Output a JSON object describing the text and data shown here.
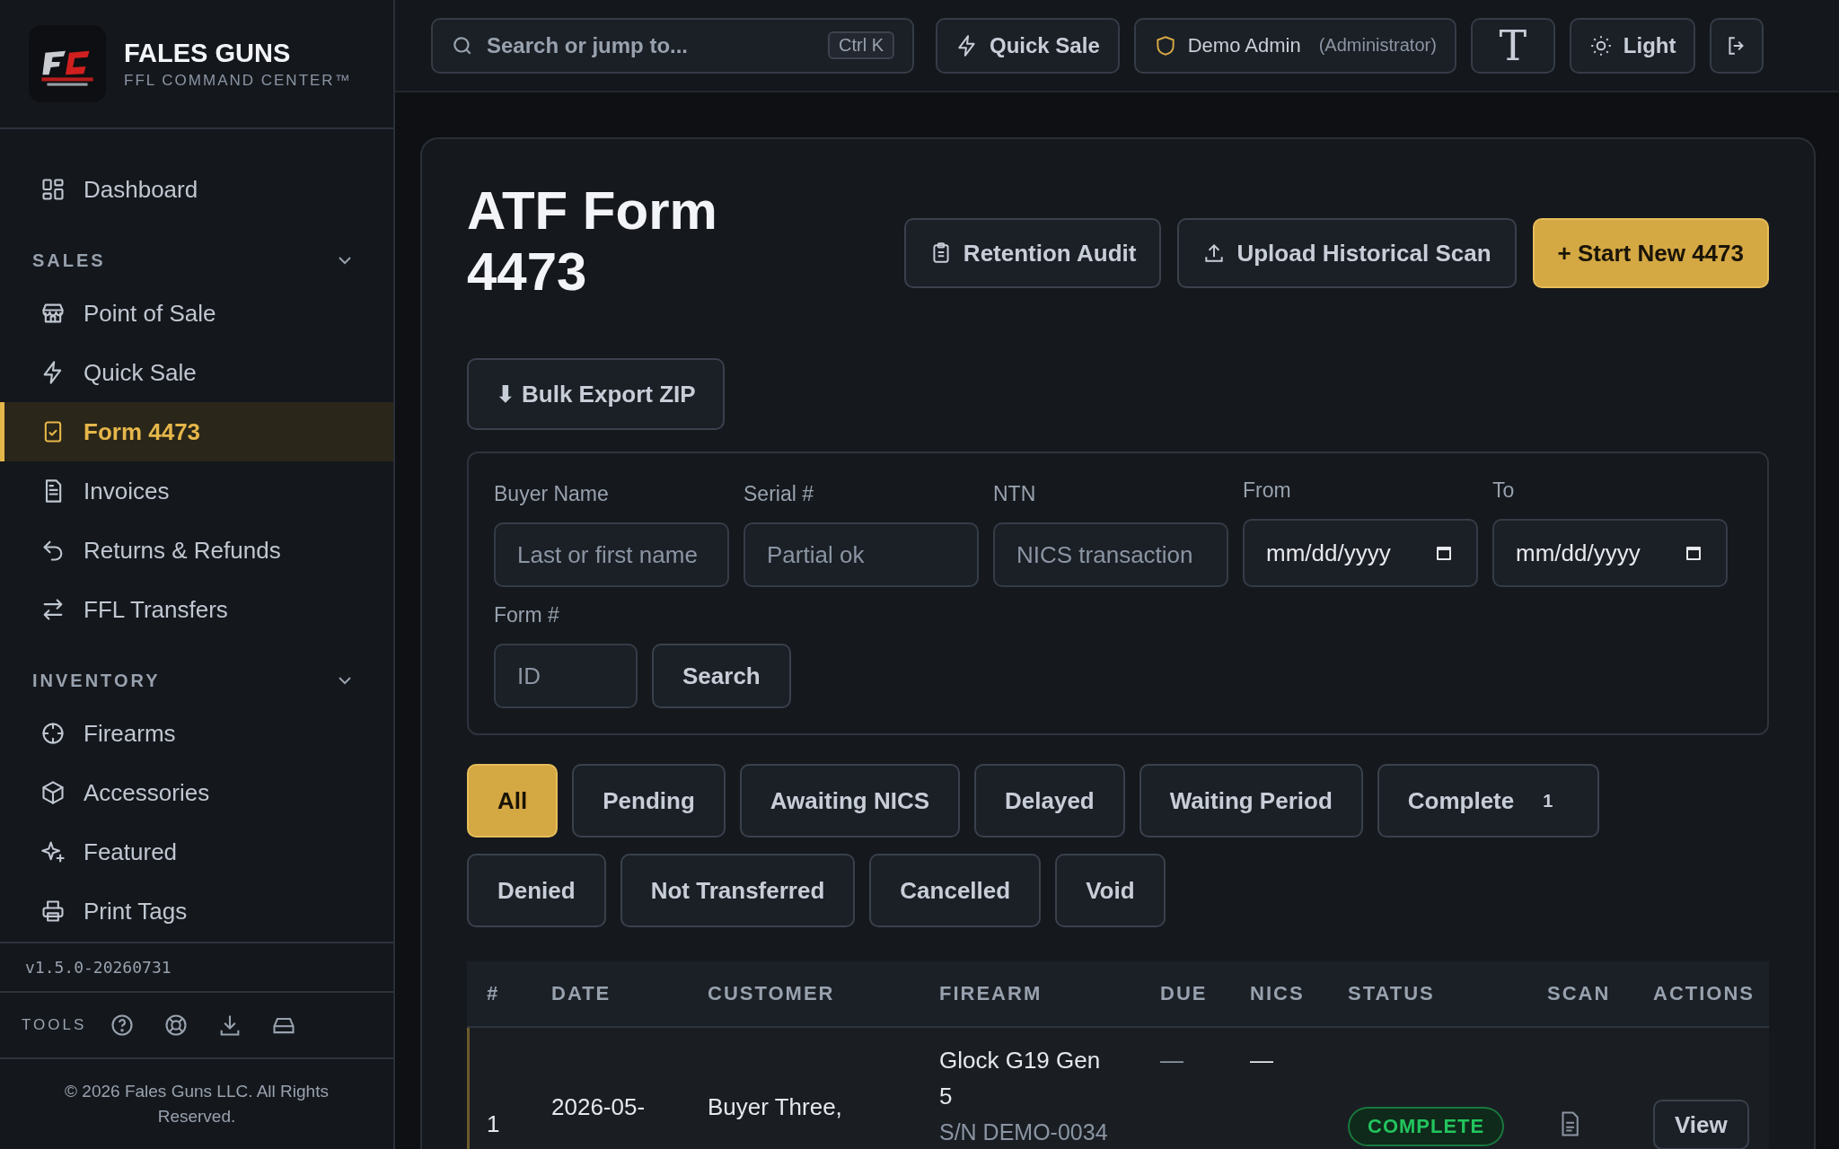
{
  "brand": {
    "name": "FALES GUNS",
    "tagline": "FFL COMMAND CENTER™"
  },
  "sidebar": {
    "top_items": [
      {
        "label": "Dashboard",
        "kind": "grid",
        "selected": false
      }
    ],
    "sections": [
      {
        "title": "SALES",
        "expanded": true,
        "items": [
          {
            "label": "Point of Sale",
            "kind": "store",
            "selected": false
          },
          {
            "label": "Quick Sale",
            "kind": "bolt",
            "selected": false
          },
          {
            "label": "Form 4473",
            "kind": "form",
            "selected": true
          },
          {
            "label": "Invoices",
            "kind": "doc",
            "selected": false
          },
          {
            "label": "Returns & Refunds",
            "kind": "undo",
            "selected": false
          },
          {
            "label": "FFL Transfers",
            "kind": "swap",
            "selected": false
          }
        ]
      },
      {
        "title": "INVENTORY",
        "expanded": true,
        "items": [
          {
            "label": "Firearms",
            "kind": "target",
            "selected": false
          },
          {
            "label": "Accessories",
            "kind": "box",
            "selected": false
          },
          {
            "label": "Featured",
            "kind": "sparkle",
            "selected": false
          },
          {
            "label": "Print Tags",
            "kind": "printer",
            "selected": false
          }
        ]
      }
    ],
    "version": "v1.5.0-20260731",
    "tools_label": "TOOLS",
    "copyright": "© 2026 Fales Guns LLC. All Rights Reserved."
  },
  "topbar": {
    "search": {
      "placeholder": "Search or jump to...",
      "shortcut": "Ctrl K"
    },
    "quick_sale": "Quick Sale",
    "user": {
      "name": "Demo Admin",
      "role": "(Administrator)"
    },
    "font_button": "T",
    "theme_button": "Light"
  },
  "page": {
    "title": "ATF Form 4473",
    "actions": [
      {
        "label": "Retention Audit",
        "kind": "audit"
      },
      {
        "label": "Upload Historical Scan",
        "kind": "upload"
      },
      {
        "label": "+ Start New 4473",
        "kind": "primary"
      }
    ],
    "bulk_export": "⬇ Bulk Export ZIP",
    "filters": [
      {
        "label": "Buyer Name",
        "placeholder": "Last or first name",
        "kind": "text"
      },
      {
        "label": "Serial #",
        "placeholder": "Partial ok",
        "kind": "text"
      },
      {
        "label": "NTN",
        "placeholder": "NICS transaction",
        "kind": "text"
      },
      {
        "label": "From",
        "value": "mm/dd/yyyy",
        "kind": "date"
      },
      {
        "label": "To",
        "value": "mm/dd/yyyy",
        "kind": "date"
      }
    ],
    "form_number": {
      "label": "Form #",
      "placeholder": "ID"
    },
    "search_button": "Search",
    "status_chips": [
      {
        "label": "All",
        "selected": true
      },
      {
        "label": "Pending",
        "selected": false
      },
      {
        "label": "Awaiting NICS",
        "selected": false
      },
      {
        "label": "Delayed",
        "selected": false
      },
      {
        "label": "Waiting Period",
        "selected": false
      },
      {
        "label": "Complete",
        "selected": false,
        "count": "1"
      },
      {
        "label": "Denied",
        "selected": false
      },
      {
        "label": "Not Transferred",
        "selected": false
      },
      {
        "label": "Cancelled",
        "selected": false
      },
      {
        "label": "Void",
        "selected": false
      }
    ],
    "table": {
      "columns": [
        "#",
        "DATE",
        "CUSTOMER",
        "FIREARM",
        "DUE",
        "NICS",
        "STATUS",
        "SCAN",
        "ACTIONS"
      ],
      "rows": [
        {
          "number": "1",
          "date": "2026-05-",
          "customer": "Buyer Three,",
          "firearm": "Glock G19 Gen 5",
          "serial": "S/N DEMO-0034",
          "due": "—",
          "nics": "—",
          "status": "COMPLETE",
          "action": "View"
        }
      ]
    }
  }
}
